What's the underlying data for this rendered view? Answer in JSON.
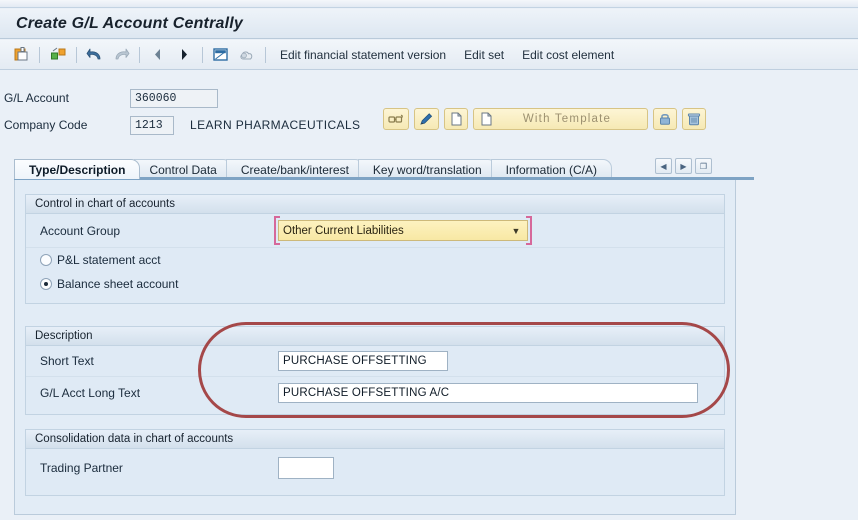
{
  "window": {
    "title": "Create G/L Account Centrally"
  },
  "toolbar": {
    "icons": [
      {
        "name": "save-icon",
        "title": "Save"
      },
      {
        "name": "check-entries-icon",
        "title": "Check entries"
      },
      {
        "name": "undo-icon",
        "title": "Undo"
      },
      {
        "name": "redo-icon",
        "title": "Redo"
      },
      {
        "name": "previous-icon",
        "title": "Previous"
      },
      {
        "name": "next-icon",
        "title": "Next"
      },
      {
        "name": "display-change-icon",
        "title": "Display/Change"
      },
      {
        "name": "cloud-icon",
        "title": "Services"
      }
    ],
    "links": [
      "Edit financial statement version",
      "Edit set",
      "Edit cost element"
    ]
  },
  "header": {
    "gl_account_label": "G/L Account",
    "gl_account_value": "360060",
    "company_code_label": "Company Code",
    "company_code_value": "1213",
    "company_name": "LEARN PHARMACEUTICALS"
  },
  "actions": {
    "display_label": "",
    "edit_label": "",
    "create_label": "",
    "with_template_label": "With Template",
    "lock_label": "",
    "delete_label": ""
  },
  "tabs": [
    {
      "label": "Type/Description",
      "active": true
    },
    {
      "label": "Control Data",
      "active": false
    },
    {
      "label": "Create/bank/interest",
      "active": false
    },
    {
      "label": "Key word/translation",
      "active": false
    },
    {
      "label": "Information (C/A)",
      "active": false
    }
  ],
  "tab_nav": {
    "prev": "◀",
    "next": "▶",
    "list": "❐"
  },
  "sections": {
    "control": {
      "header": "Control in chart of accounts",
      "account_group_label": "Account Group",
      "account_group_value": "Other Current Liabilities",
      "account_group_arrow": "▼",
      "radio_pl_label": "P&L statement acct",
      "radio_pl_selected": false,
      "radio_bs_label": "Balance sheet account",
      "radio_bs_selected": true
    },
    "description": {
      "header": "Description",
      "short_text_label": "Short Text",
      "short_text_value": "PURCHASE OFFSETTING",
      "long_text_label": "G/L Acct Long Text",
      "long_text_value": "PURCHASE OFFSETTING A/C"
    },
    "consolidation": {
      "header": "Consolidation data in chart of accounts",
      "trading_partner_label": "Trading Partner",
      "trading_partner_value": ""
    }
  },
  "colors": {
    "background": "#eaf0f7",
    "panel": "#e2ecf6",
    "group_bg": "#dfeaf5",
    "accent_yellow": "#f8e8a4",
    "annotation_red": "#a03a3a",
    "focus_pink": "#d6689a",
    "tab_underline": "#7ea3c4"
  }
}
